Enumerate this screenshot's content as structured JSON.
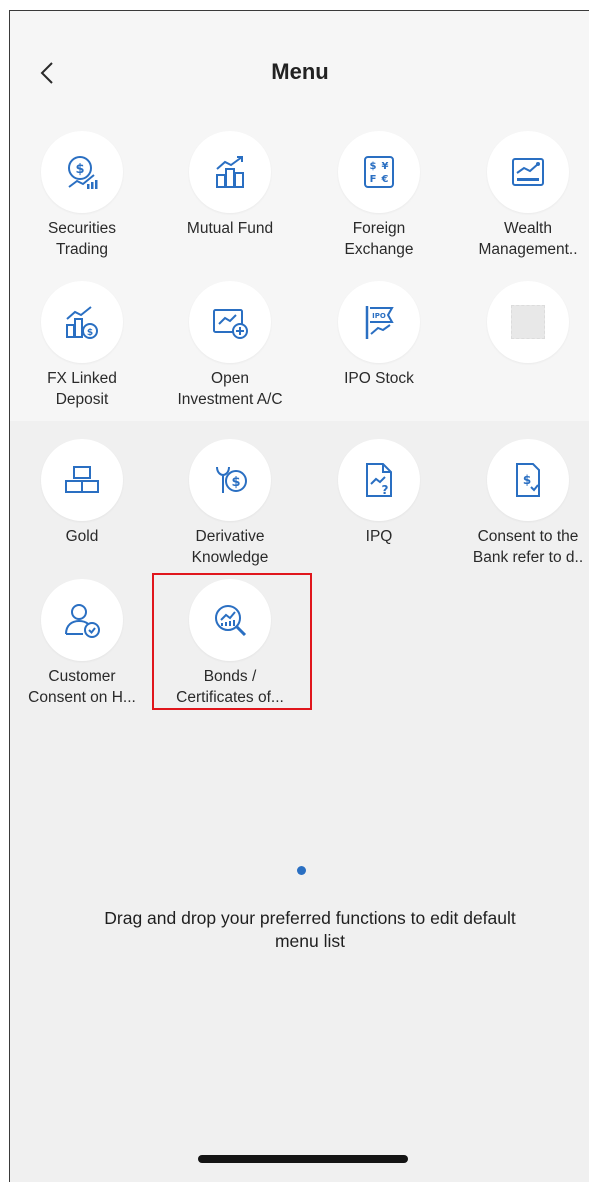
{
  "header": {
    "title": "Menu",
    "back_icon": "chevron-left-icon"
  },
  "menu": {
    "icon_color": "#2a6fc2",
    "items": [
      {
        "label": "Securities\nTrading",
        "icon": "securities-icon"
      },
      {
        "label": "Mutual Fund",
        "icon": "mutual-fund-icon"
      },
      {
        "label": "Foreign\nExchange",
        "icon": "currency-exchange-icon",
        "glyphs": [
          "$",
          "¥",
          "F",
          "€"
        ]
      },
      {
        "label": "Wealth\nManagement..",
        "icon": "wealth-chart-icon"
      },
      {
        "label": "FX Linked\nDeposit",
        "icon": "fx-deposit-icon"
      },
      {
        "label": "Open\nInvestment A/C",
        "icon": "open-account-icon"
      },
      {
        "label": "IPO Stock",
        "icon": "ipo-flag-icon",
        "badge": "IPO"
      },
      {
        "label": "",
        "icon": "empty-slot-icon"
      },
      {
        "label": "Gold",
        "icon": "gold-bars-icon"
      },
      {
        "label": "Derivative\nKnowledge",
        "icon": "derivative-icon",
        "glyph": "$"
      },
      {
        "label": "IPQ",
        "icon": "questionnaire-icon",
        "glyph": "?"
      },
      {
        "label": "Consent to the\nBank refer to d..",
        "icon": "consent-document-icon",
        "glyph": "$"
      },
      {
        "label": "Customer\nConsent on H...",
        "icon": "customer-consent-icon"
      },
      {
        "label": "Bonds /\nCertificates of...",
        "icon": "bonds-search-icon"
      }
    ]
  },
  "pagination": {
    "active_color": "#2a6fc2"
  },
  "hint": "Drag and drop your preferred functions to edit default\nmenu list",
  "highlight_color": "#e0161c"
}
